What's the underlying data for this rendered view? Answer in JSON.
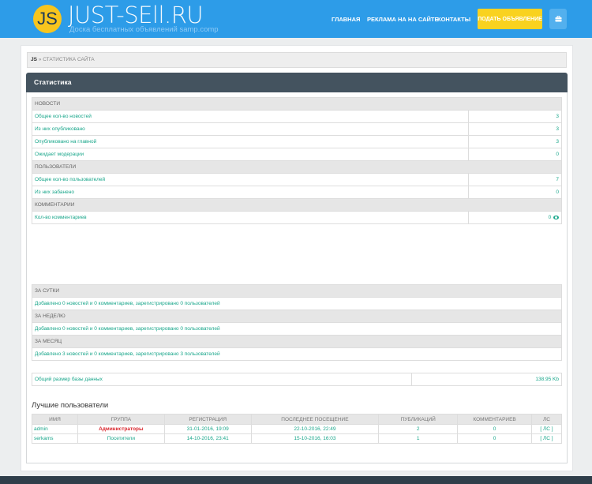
{
  "header": {
    "logo_letters": "JS",
    "logo_title": "JUST-SEll.RU",
    "logo_subtitle": "Доска бесплатных объявлений samp.comp",
    "nav": [
      "ГЛАВНАЯ",
      "РЕКЛАМА НА НА САЙТЕ",
      "КОНТАКТЫ"
    ],
    "post_button": "ПОДАТЬ ОБЪЯВЛЕНИЕ",
    "user_icon": "briefcase-icon"
  },
  "breadcrumb": {
    "home": "JS",
    "sep": " » ",
    "current": "СТАТИСТИКА САЙТА"
  },
  "panel": {
    "title": "Статистика"
  },
  "stats": {
    "news": {
      "header": "НОВОСТИ",
      "rows": [
        {
          "label": "Общее кол-во новостей",
          "value": "3"
        },
        {
          "label": "Из них опубликовано",
          "value": "3"
        },
        {
          "label": "Опубликовано на главной",
          "value": "3"
        },
        {
          "label": "Ожидает модерации",
          "value": "0"
        }
      ]
    },
    "users": {
      "header": "ПОЛЬЗОВАТЕЛИ",
      "rows": [
        {
          "label": "Общее кол-во пользователей",
          "value": "7"
        },
        {
          "label": "Из них забанено",
          "value": "0"
        }
      ]
    },
    "comments": {
      "header": "КОММЕНТАРИИ",
      "rows": [
        {
          "label": "Кол-во комментариев",
          "value": "0"
        }
      ]
    }
  },
  "periods": [
    {
      "header": "ЗА СУТКИ",
      "text": "Добавлено 0 новостей и 0 комментариев, зарегистрировано 0 пользователей"
    },
    {
      "header": "ЗА НЕДЕЛЮ",
      "text": "Добавлено 0 новостей и 0 комментариев, зарегистрировано 0 пользователей"
    },
    {
      "header": "ЗА МЕСЯЦ",
      "text": "Добавлено 3 новостей и 0 комментариев, зарегистрировано 3 пользователей"
    }
  ],
  "db": {
    "label": "Общий размер базы данных",
    "value": "138.95 Kb"
  },
  "best_users": {
    "title": "Лучшие пользователи",
    "columns": [
      "ИМЯ",
      "ГРУППА",
      "РЕГИСТРАЦИЯ",
      "ПОСЛЕДНЕЕ ПОСЕЩЕНИЕ",
      "ПУБЛИКАЦИЙ",
      "КОММЕНТАРИЕВ",
      "ЛС"
    ],
    "rows": [
      {
        "name": "admin",
        "group": "Администраторы",
        "registered": "31-01-2016, 19:09",
        "last_visit": "22-10-2016, 22:49",
        "posts": "2",
        "comments": "0",
        "pm": "[ ЛС ]"
      },
      {
        "name": "serkams",
        "group": "Посетители",
        "registered": "14-10-2016, 23:41",
        "last_visit": "15-10-2016, 16:03",
        "posts": "1",
        "comments": "0",
        "pm": "[ ЛС ]"
      }
    ]
  },
  "colors": {
    "header": "#2d9ce8",
    "accent": "#f9d21f",
    "link": "#18a68a",
    "admin_group": "#d9262d",
    "panel": "#44535f",
    "footer": "#2f3e4a"
  }
}
